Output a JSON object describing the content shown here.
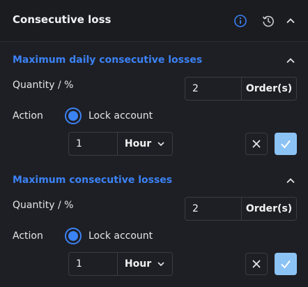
{
  "header": {
    "title": "Consecutive loss",
    "icons": [
      "info-icon",
      "history-icon",
      "chevron-up-icon"
    ]
  },
  "sections": [
    {
      "title": "Maximum daily consecutive losses",
      "quantity_label": "Quantity / %",
      "quantity_value": "2",
      "quantity_unit": "Order(s)",
      "action_label": "Action",
      "action_option": "Lock account",
      "duration_value": "1",
      "duration_unit": "Hour"
    },
    {
      "title": "Maximum consecutive losses",
      "quantity_label": "Quantity / %",
      "quantity_value": "2",
      "quantity_unit": "Order(s)",
      "action_label": "Action",
      "action_option": "Lock account",
      "duration_value": "1",
      "duration_unit": "Hour"
    }
  ],
  "colors": {
    "accent": "#3b82f6",
    "confirm_button": "#8cc3f5",
    "background": "#1e1f24"
  }
}
